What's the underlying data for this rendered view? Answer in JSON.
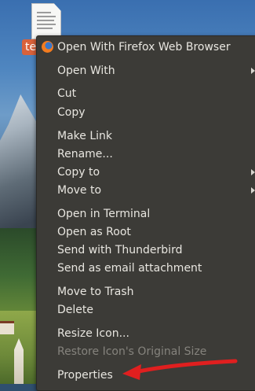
{
  "desktop": {
    "file_label": "te"
  },
  "menu": {
    "items": [
      {
        "label": "Open With Firefox Web Browser",
        "icon": "firefox-icon",
        "enabled": true
      },
      {
        "label": "Open With",
        "submenu": true,
        "enabled": true
      },
      {
        "label": "Cut",
        "enabled": true
      },
      {
        "label": "Copy",
        "enabled": true
      },
      {
        "label": "Make Link",
        "enabled": true
      },
      {
        "label": "Rename...",
        "enabled": true
      },
      {
        "label": "Copy to",
        "submenu": true,
        "enabled": true
      },
      {
        "label": "Move to",
        "submenu": true,
        "enabled": true
      },
      {
        "label": "Open in Terminal",
        "enabled": true
      },
      {
        "label": "Open as Root",
        "enabled": true
      },
      {
        "label": "Send with Thunderbird",
        "enabled": true
      },
      {
        "label": "Send as email attachment",
        "enabled": true
      },
      {
        "label": "Move to Trash",
        "enabled": true
      },
      {
        "label": "Delete",
        "enabled": true
      },
      {
        "label": "Resize Icon...",
        "enabled": true
      },
      {
        "label": "Restore Icon's Original Size",
        "enabled": false
      },
      {
        "label": "Properties",
        "enabled": true
      }
    ]
  },
  "annotation": {
    "color": "#e01f1f"
  }
}
